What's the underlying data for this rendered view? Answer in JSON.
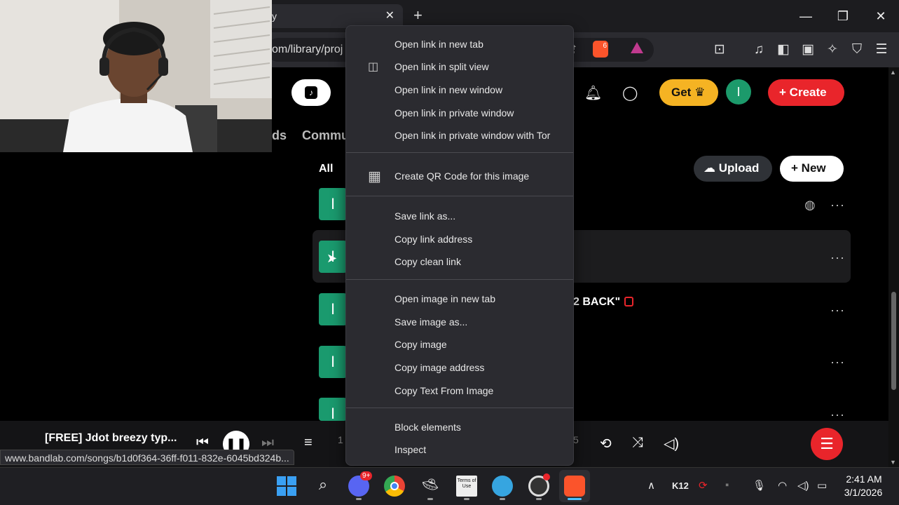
{
  "browser": {
    "tab_title": "y",
    "url_fragment": "om/library/proj",
    "shields_count": "6"
  },
  "page": {
    "get_label": "Get",
    "avatar_letter": "I",
    "create_label": "Create",
    "tab_partial_left": "ds",
    "tab_community": "Commu",
    "filter_label": "All",
    "upload_label": "Upload",
    "new_label": "New",
    "song_title_partial": "2 BACK\"",
    "thumb_letter": "I"
  },
  "player": {
    "title": "[FREE] Jdot breezy typ...",
    "time_left": "1",
    "time_right": "5"
  },
  "status_url": "www.bandlab.com/songs/b1d0f364-36ff-f011-832e-6045bd324b...",
  "context_menu": {
    "group1": [
      "Open link in new tab",
      "Open link in split view",
      "Open link in new window",
      "Open link in private window",
      "Open link in private window with Tor"
    ],
    "group2": [
      "Create QR Code for this image"
    ],
    "group3": [
      "Save link as...",
      "Copy link address",
      "Copy clean link"
    ],
    "group4": [
      "Open image in new tab",
      "Save image as...",
      "Copy image",
      "Copy image address",
      "Copy Text From Image"
    ],
    "group5": [
      "Block elements",
      "Inspect"
    ]
  },
  "taskbar": {
    "discord_badge": "9+",
    "tile_text": "Terms of Use",
    "tray_label": "K12",
    "time": "2:41 AM",
    "date": "3/1/2026"
  },
  "colors": {
    "accent_red": "#e9252b",
    "get_yellow": "#f5b323",
    "avatar_green": "#1c9a6b"
  }
}
